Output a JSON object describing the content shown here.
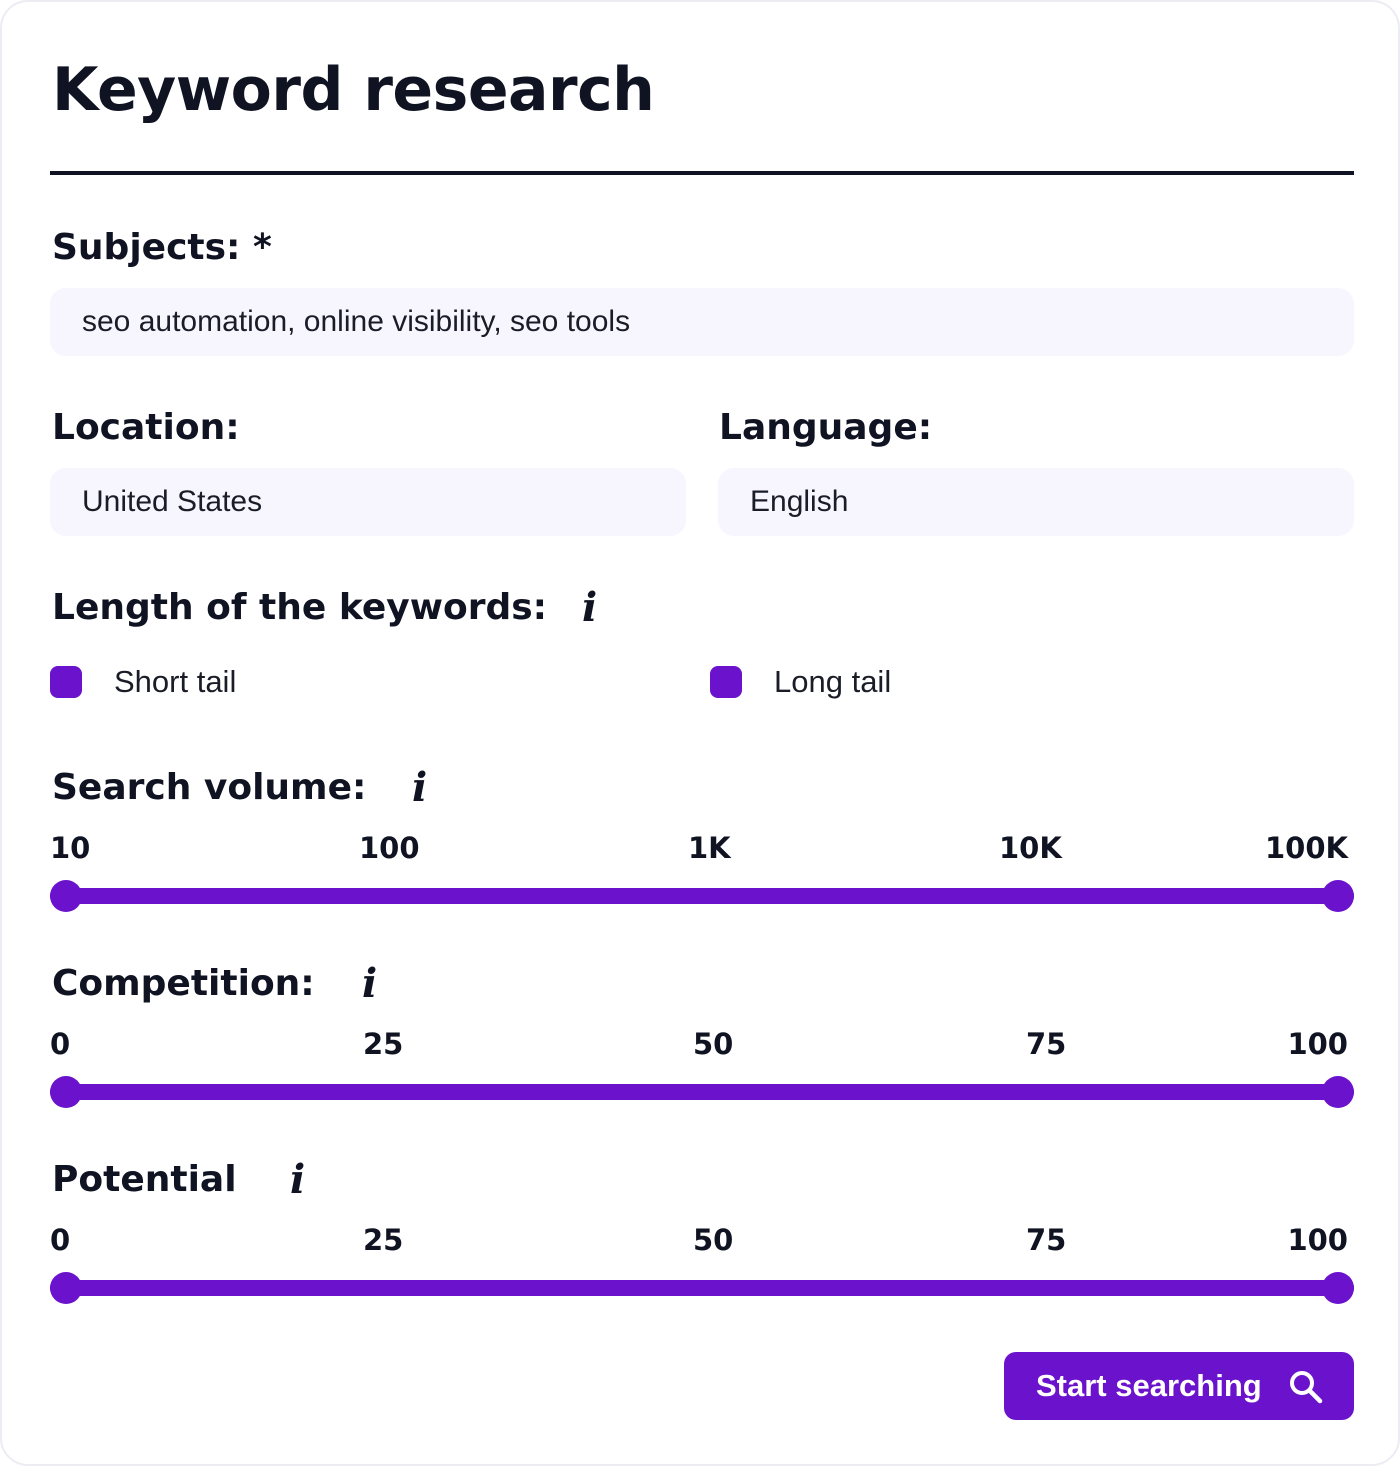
{
  "page": {
    "title": "Keyword research"
  },
  "subjects": {
    "label": "Subjects: *",
    "value": "seo automation, online visibility, seo tools"
  },
  "location": {
    "label": "Location:",
    "value": "United States"
  },
  "language": {
    "label": "Language:",
    "value": "English"
  },
  "keyword_length": {
    "label": "Length of the keywords:",
    "info_glyph": "i",
    "options": [
      {
        "label": "Short tail",
        "checked": true
      },
      {
        "label": "Long tail",
        "checked": true
      }
    ]
  },
  "search_volume": {
    "label": "Search volume:",
    "info_glyph": "i",
    "ticks": [
      "10",
      "100",
      "1K",
      "10K",
      "100K"
    ],
    "range_min": "10",
    "range_max": "100K"
  },
  "competition": {
    "label": "Competition:",
    "info_glyph": "i",
    "ticks": [
      "0",
      "25",
      "50",
      "75",
      "100"
    ],
    "range_min": 0,
    "range_max": 100
  },
  "potential": {
    "label": "Potential",
    "info_glyph": "i",
    "ticks": [
      "0",
      "25",
      "50",
      "75",
      "100"
    ],
    "range_min": 0,
    "range_max": 100
  },
  "search_button": {
    "label": "Start searching",
    "icon": "search-icon"
  },
  "colors": {
    "accent": "#6a12cc",
    "text": "#101322",
    "field_bg": "#f7f5fe"
  }
}
